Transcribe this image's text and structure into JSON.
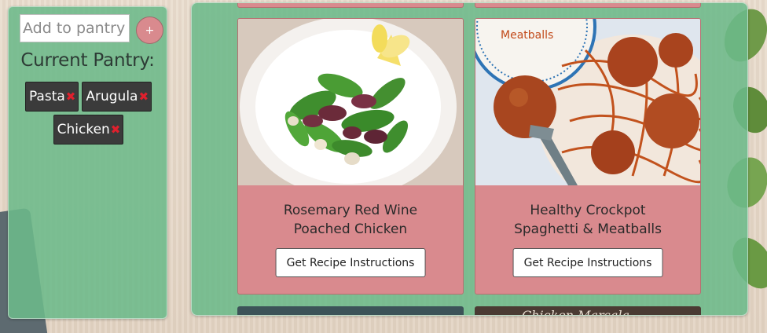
{
  "pantry": {
    "input_placeholder": "Add to pantry",
    "add_button_label": "+",
    "title": "Current Pantry:",
    "remove_glyph": "✖",
    "items": [
      {
        "label": "Pasta"
      },
      {
        "label": "Arugula"
      },
      {
        "label": "Chicken"
      }
    ]
  },
  "recipes": [
    {
      "title": "Rosemary Red Wine\nPoached Chicken",
      "button_label": "Get Recipe Instructions"
    },
    {
      "title": "Healthy Crockpot\nSpaghetti & Meatballs",
      "image_text": "Meatballs",
      "button_label": "Get Recipe Instructions"
    }
  ],
  "lower_recipe": {
    "image_text": "Chicken Marsala"
  },
  "colors": {
    "panel": "#6cba8a",
    "card": "#d98a8e",
    "chip": "#3b3b3b",
    "remove": "#e0202d"
  }
}
